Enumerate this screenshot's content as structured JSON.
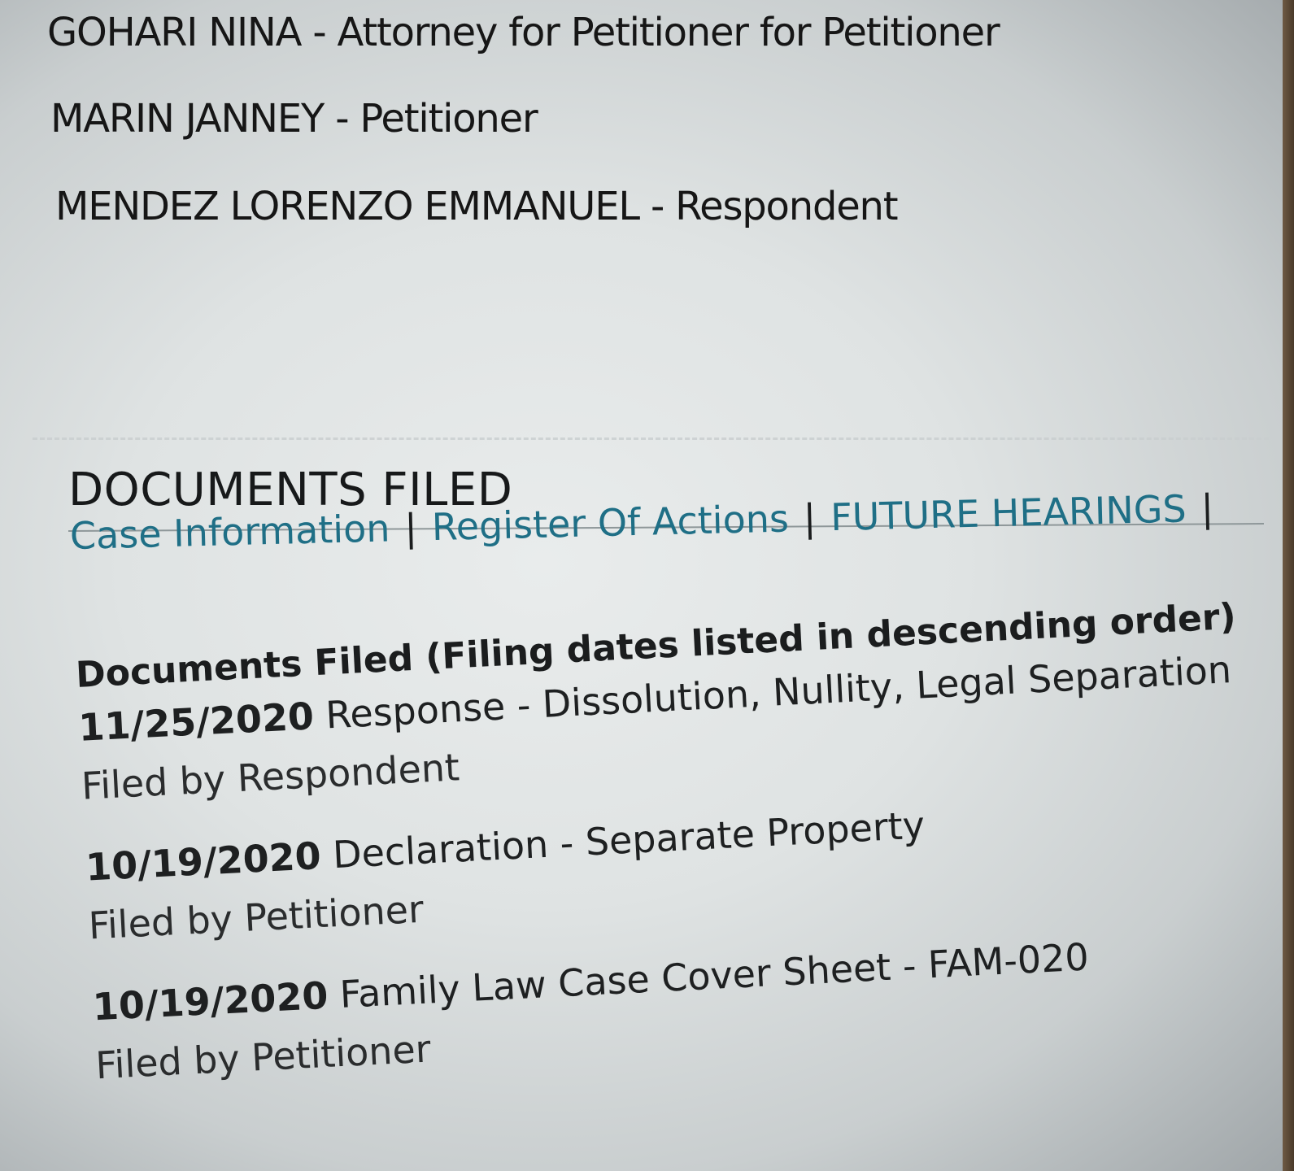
{
  "parties": [
    {
      "name": "GOHARI NINA",
      "role": "Attorney for Petitioner for Petitioner"
    },
    {
      "name": "MARIN JANNEY",
      "role": "Petitioner"
    },
    {
      "name": "MENDEZ LORENZO EMMANUEL",
      "role": "Respondent"
    }
  ],
  "section_title": "DOCUMENTS FILED",
  "nav": {
    "case_information": "Case Information",
    "register_of_actions": "Register Of Actions",
    "future_hearings": "FUTURE HEARINGS",
    "separator": "|"
  },
  "documents": {
    "heading": "Documents Filed (Filing dates listed in descending order)",
    "items": [
      {
        "date": "11/25/2020",
        "title": "Response - Dissolution, Nullity, Legal Separation",
        "filed_by": "Filed by Respondent"
      },
      {
        "date": "10/19/2020",
        "title": "Declaration - Separate Property",
        "filed_by": "Filed by Petitioner"
      },
      {
        "date": "10/19/2020",
        "title": "Family Law Case Cover Sheet - FAM-020",
        "filed_by": "Filed by Petitioner"
      }
    ]
  }
}
